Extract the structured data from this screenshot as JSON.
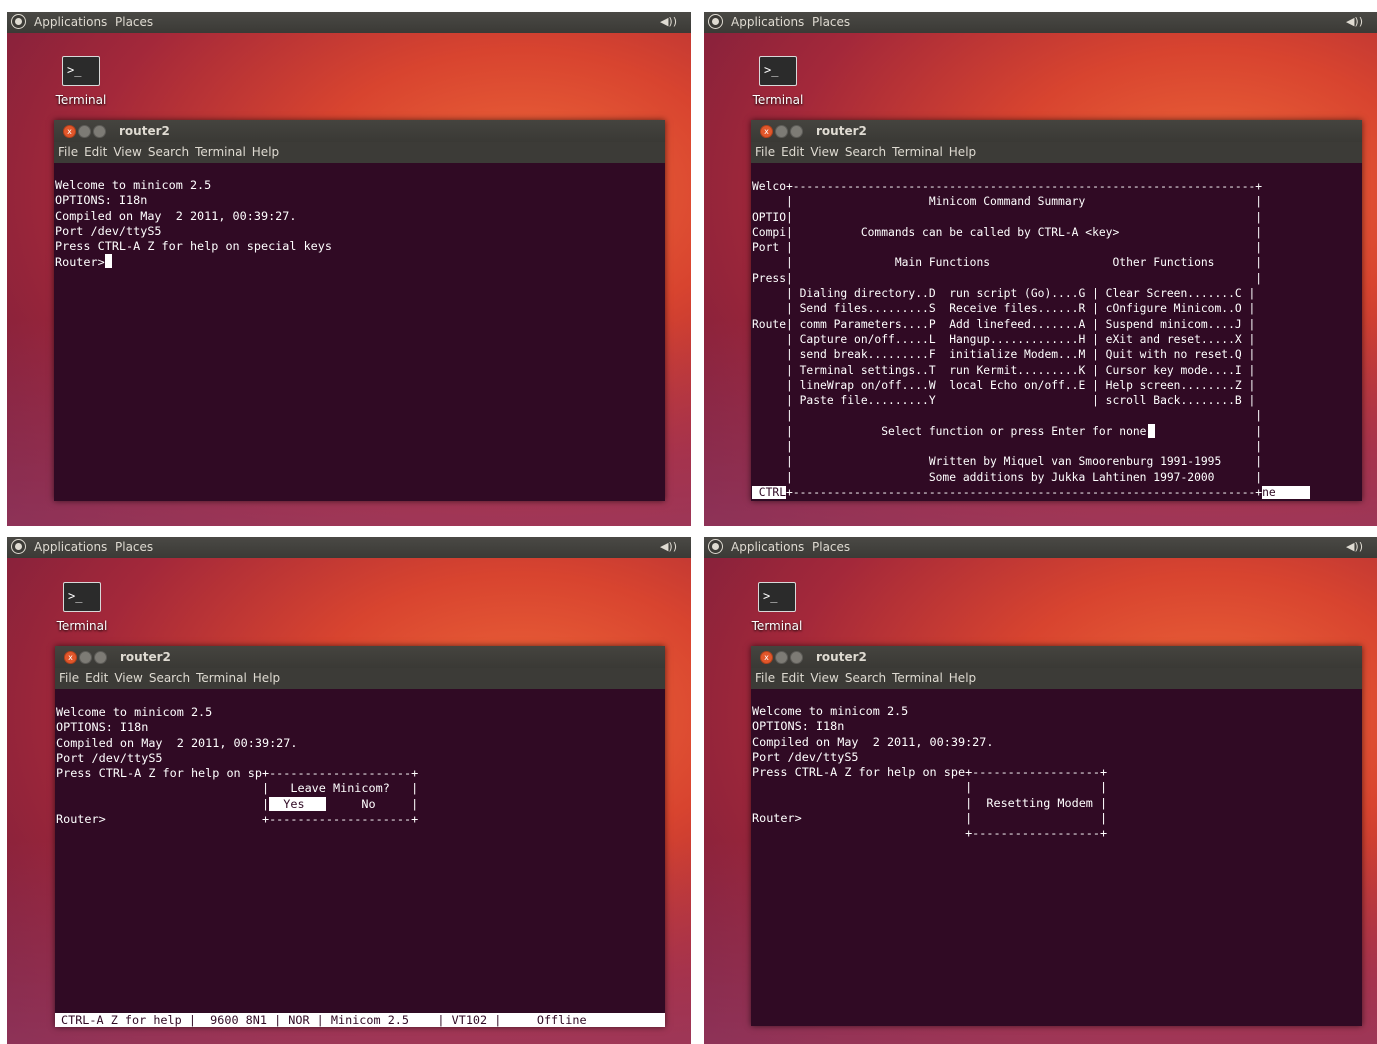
{
  "desktop": {
    "panel": {
      "applications_label": "Applications",
      "places_label": "Places",
      "volume_icon": "◀))"
    },
    "terminal_icon_label": "Terminal",
    "window_title": "router2",
    "menu": [
      "File",
      "Edit",
      "View",
      "Search",
      "Terminal",
      "Help"
    ],
    "close_glyph": "x",
    "terminal_icon_glyph": ">_"
  },
  "screen1": {
    "lines": [
      "Welcome to minicom 2.5",
      "",
      "OPTIONS: I18n",
      "Compiled on May  2 2011, 00:39:27.",
      "Port /dev/ttyS5",
      "",
      "Press CTRL-A Z for help on special keys",
      "",
      ""
    ],
    "prompt": "Router>"
  },
  "screen2": {
    "lines": [
      "Welco+--------------------------------------------------------------------+",
      "     |                    Minicom Command Summary                         |",
      "OPTIO|                                                                    |",
      "Compi|          Commands can be called by CTRL-A <key>                    |",
      "Port |                                                                    |",
      "     |               Main Functions                  Other Functions      |",
      "Press|                                                                    |",
      "     | Dialing directory..D  run script (Go)....G | Clear Screen.......C |",
      "     | Send files.........S  Receive files......R | cOnfigure Minicom..O |",
      "Route| comm Parameters....P  Add linefeed.......A | Suspend minicom....J |",
      "     | Capture on/off.....L  Hangup.............H | eXit and reset.....X |",
      "     | send break.........F  initialize Modem...M | Quit with no reset.Q |",
      "     | Terminal settings..T  run Kermit.........K | Cursor key mode....I |",
      "     | lineWrap on/off....W  local Echo on/off..E | Help screen........Z |",
      "     | Paste file.........Y                       | scroll Back........B |",
      "     |                                                                    |",
      "     |             Select function or press Enter for none.               |",
      "     |                                                                    |",
      "     |                    Written by Miquel van Smoorenburg 1991-1995     |",
      "     |                    Some additions by Jukka Lahtinen 1997-2000      |"
    ],
    "bottom_left": " CTRL",
    "bottom_border": "+--------------------------------------------------------------------+",
    "bottom_right": "ne     "
  },
  "screen3": {
    "lines": [
      "Welcome to minicom 2.5",
      "",
      "OPTIONS: I18n",
      "Compiled on May  2 2011, 00:39:27.",
      "Port /dev/ttyS5",
      "",
      "Press CTRL-A Z for help on sp+--------------------+",
      "                             |   Leave Minicom?   |",
      "                             |",
      "Router>                      +--------------------+"
    ],
    "dialog_yes": "  Yes   ",
    "dialog_no": "     No     |",
    "statusbar": "CTRL-A Z for help |  9600 8N1 | NOR | Minicom 2.5    | VT102 |     Offline"
  },
  "screen4": {
    "lines": [
      "Welcome to minicom 2.5",
      "",
      "OPTIONS: I18n",
      "Compiled on May  2 2011, 00:39:27.",
      "Port /dev/ttyS5",
      "",
      "Press CTRL-A Z for help on spe+------------------+",
      "                              |                  |",
      "                              |  Resetting Modem |",
      "Router>                       |                  |",
      "                              +------------------+"
    ]
  }
}
